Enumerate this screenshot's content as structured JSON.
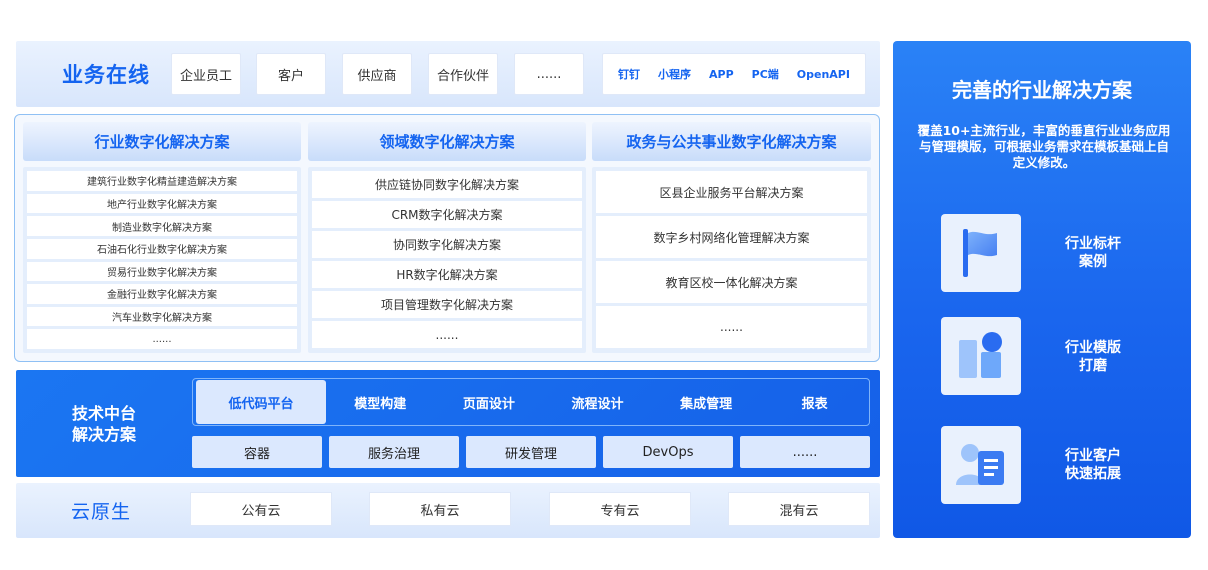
{
  "business": {
    "title": "业务在线",
    "roles": [
      "企业员工",
      "客户",
      "供应商",
      "合作伙伴",
      "......"
    ],
    "channels": [
      "钉钉",
      "小程序",
      "APP",
      "PC端",
      "OpenAPI"
    ]
  },
  "solutions": {
    "columns": [
      {
        "title": "行业数字化解决方案",
        "items": [
          "建筑行业数字化精益建造解决方案",
          "地产行业数字化解决方案",
          "制造业数字化解决方案",
          "石油石化行业数字化解决方案",
          "贸易行业数字化解决方案",
          "金融行业数字化解决方案",
          "汽车业数字化解决方案",
          "......"
        ]
      },
      {
        "title": "领域数字化解决方案",
        "items": [
          "供应链协同数字化解决方案",
          "CRM数字化解决方案",
          "协同数字化解决方案",
          "HR数字化解决方案",
          "项目管理数字化解决方案",
          "......"
        ]
      },
      {
        "title": "政务与公共事业数字化解决方案",
        "items": [
          "区县企业服务平台解决方案",
          "数字乡村网络化管理解决方案",
          "教育区校一体化解决方案",
          "......"
        ]
      }
    ]
  },
  "tech": {
    "title_line1": "技术中台",
    "title_line2": "解决方案",
    "tabs": [
      "低代码平台",
      "模型构建",
      "页面设计",
      "流程设计",
      "集成管理",
      "报表"
    ],
    "items": [
      "容器",
      "服务治理",
      "研发管理",
      "DevOps",
      "......"
    ]
  },
  "cloud": {
    "title": "云原生",
    "items": [
      "公有云",
      "私有云",
      "专有云",
      "混有云"
    ]
  },
  "panel": {
    "title": "完善的行业解决方案",
    "description": "覆盖10+主流行业，丰富的垂直行业业务应用与管理模版，可根据业务需求在模板基础上自定义修改。",
    "features": [
      {
        "label": "行业标杆\n案例",
        "icon": "flag-icon"
      },
      {
        "label": "行业模版\n打磨",
        "icon": "template-icon"
      },
      {
        "label": "行业客户\n快速拓展",
        "icon": "customer-icon"
      }
    ],
    "accent": "#1464f0"
  }
}
